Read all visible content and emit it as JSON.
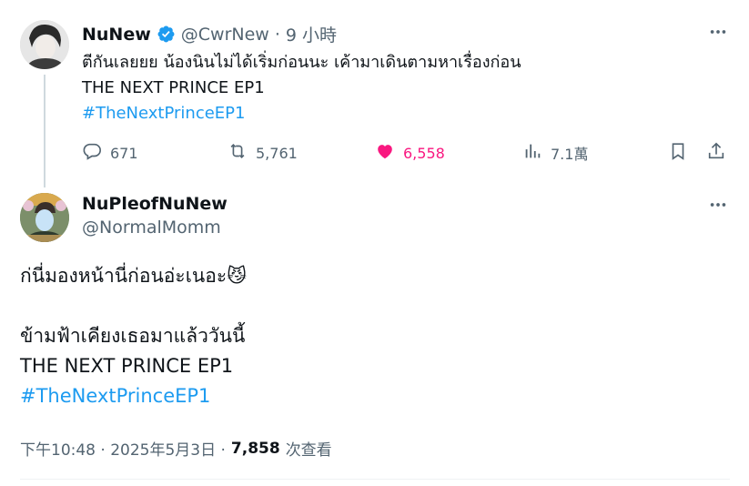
{
  "tweet": {
    "author_name": "NuNew",
    "author_handle": "@CwrNew",
    "separator": "·",
    "time_ago": "9 小時",
    "text_line1": "ตีกันเลยยย น้องนินไม่ได้เริ่มก่อนนะ เค้ามาเดินตามหาเรื่องก่อน",
    "text_line2": "THE NEXT PRINCE EP1",
    "hashtag": "#TheNextPrinceEP1",
    "replies": "671",
    "reposts": "5,761",
    "likes": "6,558",
    "views": "7.1萬"
  },
  "reply": {
    "author_name": "NuPleofNuNew",
    "author_handle": "@NormalMomm",
    "text_line1": "ก่นี่มองหน้านี่ก่อนอ่ะเนอะ",
    "emoji": "😼",
    "text_line2": "ข้ามฟ้าเคียงเธอมาแล้ววันนี้",
    "text_line3": "THE NEXT PRINCE EP1",
    "hashtag": "#TheNextPrinceEP1",
    "timestamp": "下午10:48 · 2025年5月3日 ·",
    "view_count": "7,858",
    "view_label": "次查看"
  },
  "colors": {
    "accent": "#1d9bf0",
    "like": "#f91880",
    "muted": "#536471"
  },
  "icons": [
    "verified-badge-icon",
    "more-icon",
    "reply-icon",
    "repost-icon",
    "like-icon",
    "views-icon",
    "bookmark-icon",
    "share-icon"
  ]
}
